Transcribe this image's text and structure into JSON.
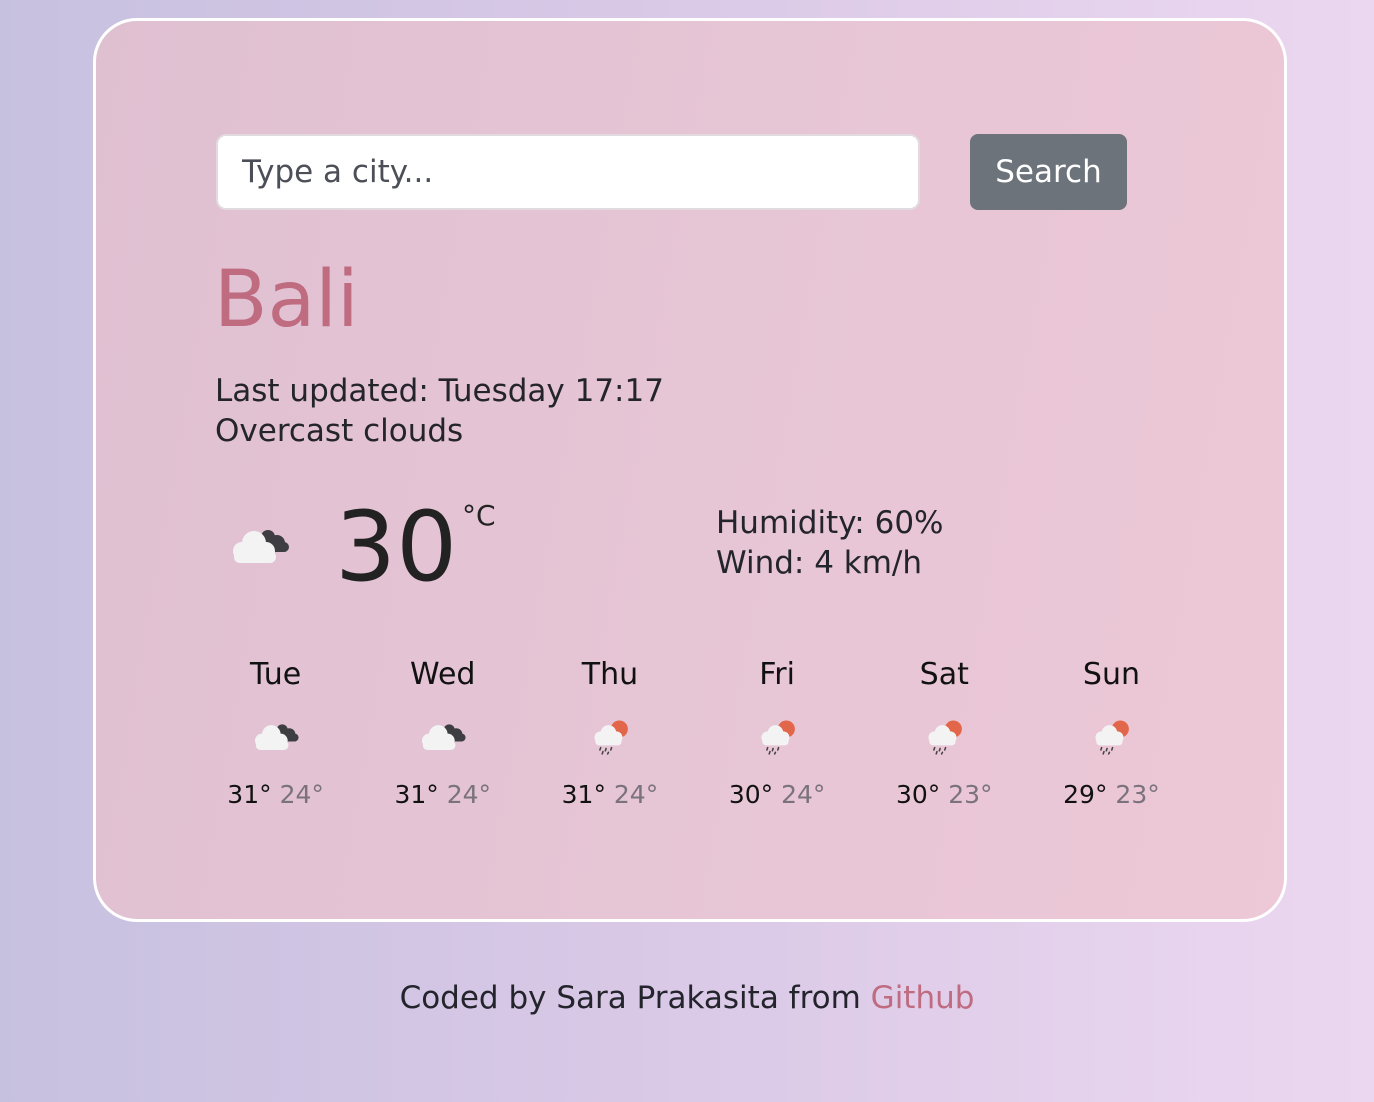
{
  "search": {
    "placeholder": "Type a city...",
    "button_label": "Search"
  },
  "current": {
    "city": "Bali",
    "last_updated": "Last updated: Tuesday 17:17",
    "description": "Overcast clouds",
    "temperature": "30",
    "unit": "°C",
    "humidity": "Humidity: 60%",
    "wind": "Wind: 4 km/h",
    "icon": "overcast-clouds-icon"
  },
  "forecast": [
    {
      "day": "Tue",
      "max": "31°",
      "min": "24°",
      "icon": "overcast-clouds-icon"
    },
    {
      "day": "Wed",
      "max": "31°",
      "min": "24°",
      "icon": "overcast-clouds-icon"
    },
    {
      "day": "Thu",
      "max": "31°",
      "min": "24°",
      "icon": "rain-sun-icon"
    },
    {
      "day": "Fri",
      "max": "30°",
      "min": "24°",
      "icon": "rain-sun-icon"
    },
    {
      "day": "Sat",
      "max": "30°",
      "min": "23°",
      "icon": "rain-sun-icon"
    },
    {
      "day": "Sun",
      "max": "29°",
      "min": "23°",
      "icon": "rain-sun-icon"
    }
  ],
  "footer": {
    "text": "Coded by Sara Prakasita from ",
    "link_label": "Github"
  },
  "colors": {
    "accent": "#bf6b80",
    "button": "#6c737a",
    "card_border": "#ffffff"
  }
}
